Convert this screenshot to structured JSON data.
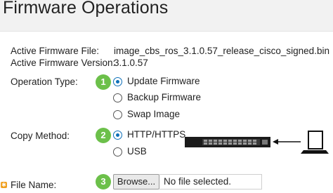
{
  "page": {
    "title": "Firmware Operations"
  },
  "firmware": {
    "active_file_label": "Active Firmware File:",
    "active_file_value": "image_cbs_ros_3.1.0.57_release_cisco_signed.bin",
    "active_version_label": "Active Firmware Version:",
    "active_version_value": "3.1.0.57"
  },
  "operation_type": {
    "label": "Operation Type:",
    "step": "1",
    "options": [
      "Update Firmware",
      "Backup Firmware",
      "Swap Image"
    ],
    "selected": "Update Firmware"
  },
  "copy_method": {
    "label": "Copy Method:",
    "step": "2",
    "options": [
      "HTTP/HTTPS",
      "USB"
    ],
    "selected": "HTTP/HTTPS"
  },
  "file_name": {
    "label": "File Name:",
    "step": "3",
    "browse_label": "Browse...",
    "status": "No file selected.",
    "required_icon": "asterisk-icon"
  },
  "illustration": {
    "icons": [
      "switch-icon",
      "arrow-left-icon",
      "laptop-icon"
    ],
    "colors": {
      "switch": "#1b1b1b",
      "laptop": "#111111",
      "step_badge": "#6cc04a",
      "radio_accent": "#0d6fb8"
    }
  }
}
